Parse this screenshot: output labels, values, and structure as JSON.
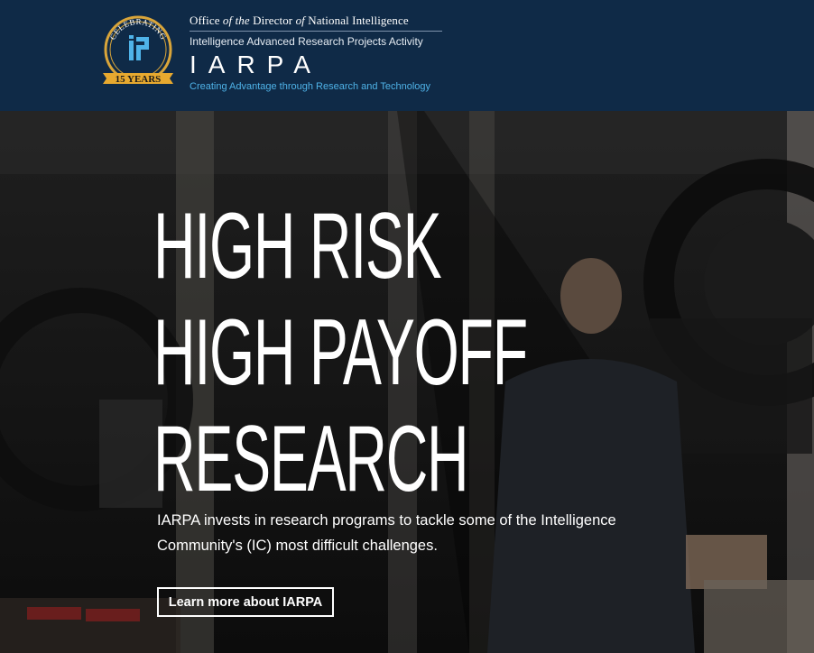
{
  "header": {
    "badge": {
      "top_text": "CELEBRATING",
      "ribbon_text": "15 YEARS",
      "icon": "iarpa-monogram-icon",
      "colors": {
        "ring": "#d9a53a",
        "monogram": "#4fb3e8",
        "ribbon": "#e7a92f"
      }
    },
    "office_prefix": "Office ",
    "office_of_the": "of the",
    "office_director": " Director ",
    "office_of": "of",
    "office_suffix": " National Intelligence",
    "agency_full_name": "Intelligence Advanced Research Projects Activity",
    "wordmark": "IARPA",
    "tagline": "Creating Advantage through Research and Technology",
    "colors": {
      "background": "#0f2a47",
      "tagline": "#4fb3e8"
    }
  },
  "hero": {
    "headline_lines": [
      "HIGH RISK",
      "HIGH PAYOFF",
      "RESEARCH"
    ],
    "intro": "IARPA invests in research programs to tackle some of the Intelligence Community's (IC) most difficult challenges.",
    "cta_label": "Learn more about IARPA",
    "background_description_icon": "lab-photo"
  }
}
